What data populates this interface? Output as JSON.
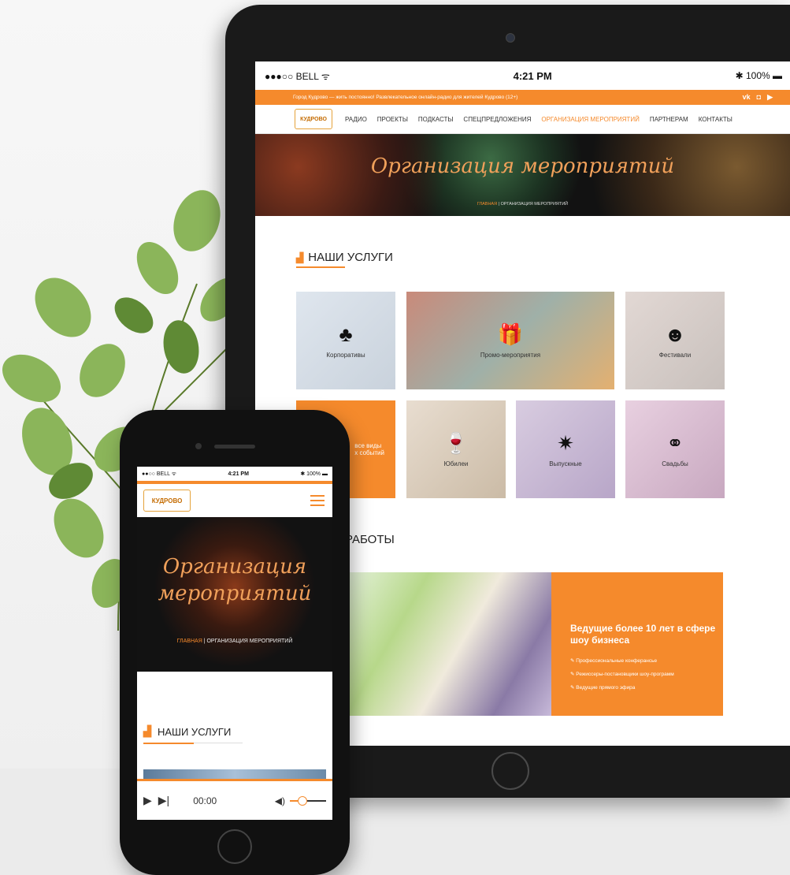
{
  "tablet": {
    "status": {
      "carrier": "●●●○○ BELL ᯤ",
      "time": "4:21 PM",
      "battery": "✱ 100% ▬"
    },
    "topbar": {
      "tagline": "Город Кудрово — жить постоянно! Развлекательное онлайн-радио для жителей Кудрово (12+)",
      "social": [
        "vk",
        "◘",
        "▶"
      ]
    },
    "logo": "КУДРОВО",
    "nav": [
      "РАДИО",
      "ПРОЕКТЫ",
      "ПОДКАСТЫ",
      "СПЕЦПРЕДЛОЖЕНИЯ",
      "ОРГАНИЗАЦИЯ МЕРОПРИЯТИЙ",
      "ПАРТНЕРАМ",
      "КОНТАКТЫ"
    ],
    "active_nav": "ОРГАНИЗАЦИЯ МЕРОПРИЯТИЙ",
    "hero": {
      "title": "Организация мероприятий",
      "crumb_home": "ГЛАВНАЯ",
      "crumb_current": "ОРГАНИЗАЦИЯ МЕРОПРИЯТИЙ"
    },
    "services_title": "НАШИ УСЛУГИ",
    "services": [
      {
        "label": "Корпоративы",
        "icon": "tuxedo-icon"
      },
      {
        "label": "Промо-мероприятия",
        "icon": "gift-icon"
      },
      {
        "label": "Фестивали",
        "icon": "mask-icon"
      },
      {
        "label": "все виды\nх событий",
        "icon": ""
      },
      {
        "label": "Юбилеи",
        "icon": "wine-glass-icon"
      },
      {
        "label": "Выпускные",
        "icon": "fireworks-icon"
      },
      {
        "label": "Свадьбы",
        "icon": "rings-icon"
      }
    ],
    "works_title": "РАБОТЫ",
    "works_box": {
      "heading": "Ведущие более 10 лет в сфере шоу бизнеса",
      "items": [
        "Профессиональные конферансье",
        "Режиссеры-постановщики шоу-программ",
        "Ведущие прямого эфира"
      ]
    },
    "colors": {
      "accent": "#f58a2c"
    }
  },
  "phone": {
    "status": {
      "carrier": "●●○○ BELL ᯤ",
      "time": "4:21 PM",
      "battery": "✱ 100% ▬"
    },
    "logo": "КУДРОВО",
    "hero": {
      "title": "Организация мероприятий",
      "crumb_home": "ГЛАВНАЯ",
      "crumb_current": "ОРГАНИЗАЦИЯ МЕРОПРИЯТИЙ"
    },
    "services_title": "НАШИ УСЛУГИ",
    "player": {
      "time": "00:00",
      "volume": 0.33
    }
  }
}
